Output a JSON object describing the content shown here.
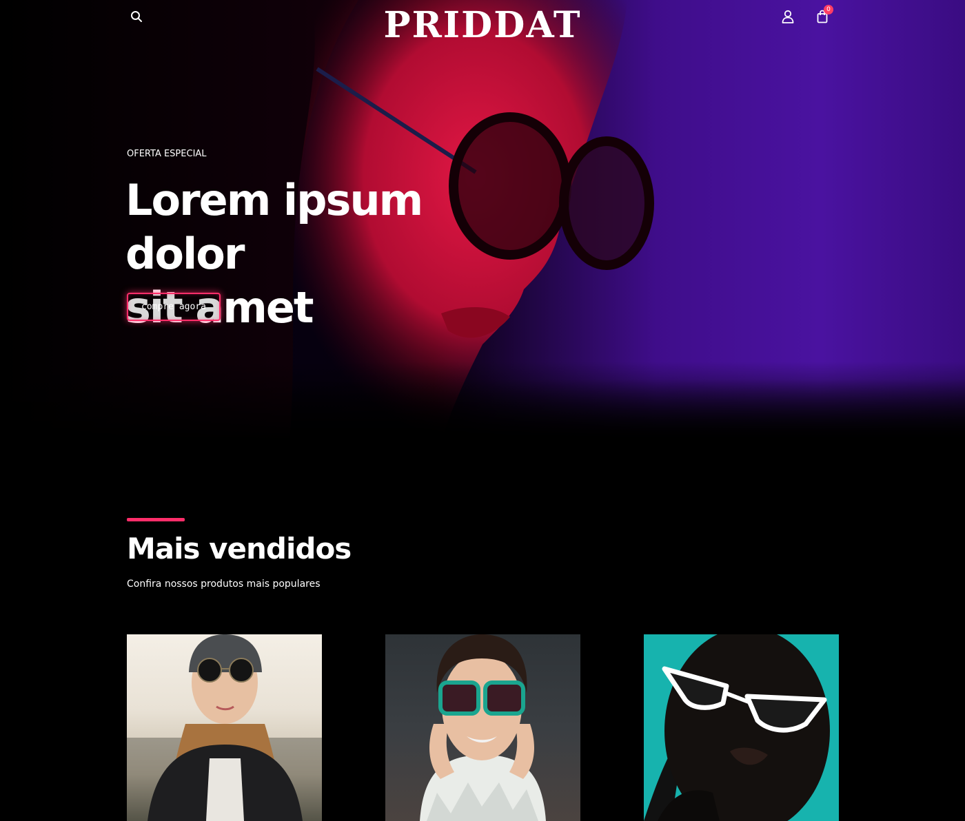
{
  "header": {
    "logo": "PRIDDAT",
    "cart_count": "0",
    "icons": [
      "search-icon",
      "user-icon",
      "shopping-bag-icon"
    ]
  },
  "hero": {
    "eyebrow": "OFERTA ESPECIAL",
    "title_line1": "Lorem ipsum dolor",
    "title_line2": "sit amet",
    "cta_label": "compre agora"
  },
  "best_sellers": {
    "title": "Mais vendidos",
    "subtitle": "Confira nossos produtos mais populares"
  },
  "colors": {
    "accent": "#ff2e6a",
    "hero_purple": "#4a12a0",
    "hero_red": "#d4123c",
    "background": "#000000",
    "product3_bg": "#17b3ae"
  }
}
